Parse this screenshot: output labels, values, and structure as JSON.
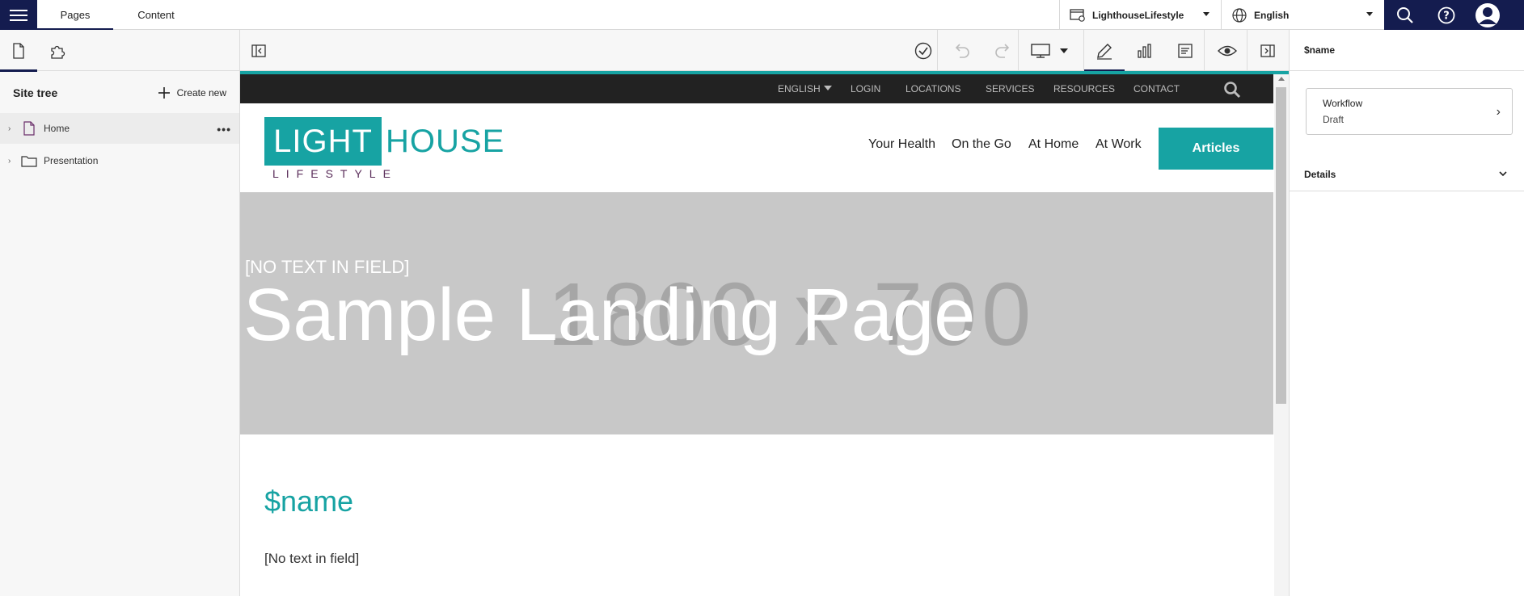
{
  "topbar": {
    "tabs": [
      {
        "label": "Pages"
      },
      {
        "label": "Content"
      }
    ],
    "site_selector": "LighthouseLifestyle",
    "language_selector": "English"
  },
  "left_panel": {
    "site_tree_title": "Site tree",
    "create_new_label": "Create new",
    "tree": [
      {
        "label": "Home",
        "type": "page",
        "selected": true
      },
      {
        "label": "Presentation",
        "type": "folder",
        "selected": false
      }
    ]
  },
  "right_panel": {
    "title": "$name",
    "workflow_label": "Workflow",
    "workflow_status": "Draft",
    "details_label": "Details"
  },
  "canvas": {
    "site_nav": {
      "language": "ENGLISH",
      "links": [
        "LOGIN",
        "LOCATIONS",
        "SERVICES",
        "RESOURCES",
        "CONTACT"
      ]
    },
    "logo": {
      "light": "LIGHT",
      "house": "HOUSE",
      "lifestyle": "LIFESTYLE"
    },
    "main_nav": [
      "Your Health",
      "On the Go",
      "At Home",
      "At Work"
    ],
    "articles_button": "Articles",
    "hero": {
      "placeholder": "1800 x 700",
      "eyebrow": "[NO TEXT IN FIELD]",
      "title": "Sample Landing Page"
    },
    "content_title": "$name",
    "content_body": "[No text in field]"
  },
  "colors": {
    "navy": "#141c4f",
    "teal": "#17a3a3",
    "logo_purple": "#5a2d5a"
  },
  "icons": {
    "hamburger": "hamburger-menu-icon",
    "search": "search-icon",
    "help": "help-icon",
    "avatar": "avatar-icon",
    "page": "page-icon",
    "blocks": "puzzle-icon",
    "publish": "check-circle-icon",
    "undo": "undo-icon",
    "redo": "redo-icon",
    "device": "desktop-icon",
    "edit": "pencil-icon",
    "analytics": "bar-chart-icon",
    "properties": "form-icon",
    "preview": "eye-icon"
  }
}
